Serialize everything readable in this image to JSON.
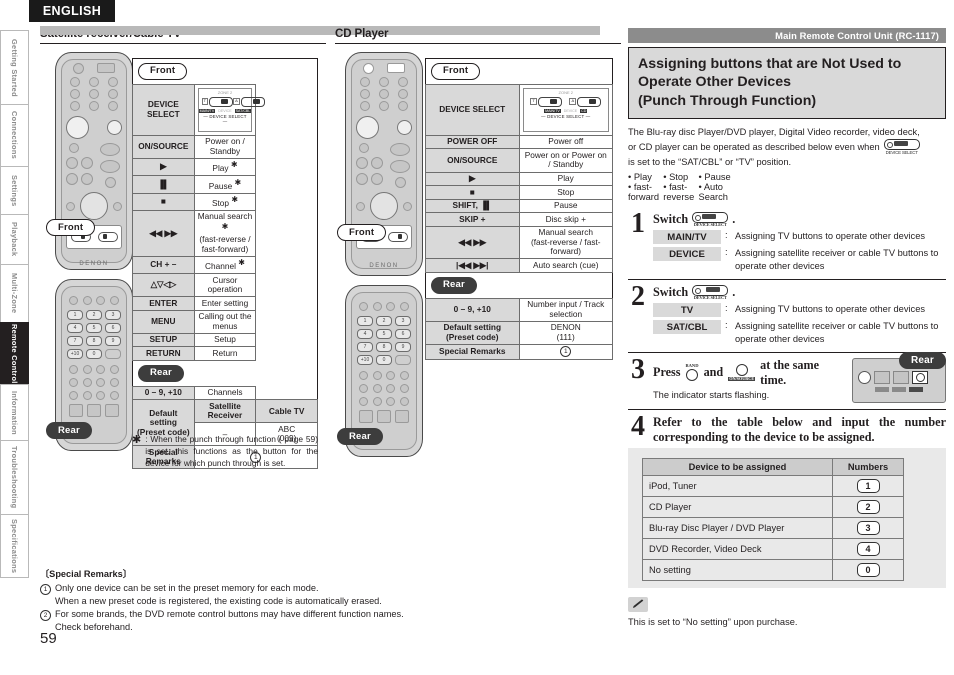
{
  "language_tab": "ENGLISH",
  "page_number": "59",
  "side_tabs": [
    {
      "label": "Getting Started",
      "active": false
    },
    {
      "label": "Connections",
      "active": false
    },
    {
      "label": "Settings",
      "active": false
    },
    {
      "label": "Playback",
      "active": false
    },
    {
      "label": "Multi-Zone",
      "active": false
    },
    {
      "label": "Remote Control",
      "active": true
    },
    {
      "label": "Information",
      "active": false
    },
    {
      "label": "Troubleshooting",
      "active": false
    },
    {
      "label": "Specifications",
      "active": false
    }
  ],
  "left_column": {
    "title": "Satellite receiver/Cable TV",
    "front_label": "Front",
    "rear_label": "Rear",
    "rows": [
      {
        "key": "DEVICE SELECT",
        "value": "",
        "type": "devsel"
      },
      {
        "key": "ON/SOURCE",
        "value": "Power on / Standby"
      },
      {
        "key": "▶",
        "value": "Play",
        "star": true
      },
      {
        "key": "▐▌",
        "value": "Pause",
        "star": true
      },
      {
        "key": "■",
        "value": "Stop",
        "star": true
      },
      {
        "key": "◀◀  ▶▶",
        "value": "Manual search",
        "value2": "(fast-reverse / fast-forward)",
        "star": true
      },
      {
        "key": "CH + –",
        "value": "Channel",
        "star": true
      },
      {
        "key": "△▽◁▷",
        "value": "Cursor operation"
      },
      {
        "key": "ENTER",
        "value": "Enter setting"
      },
      {
        "key": "MENU",
        "value": "Calling out the menus"
      },
      {
        "key": "SETUP",
        "value": "Setup"
      },
      {
        "key": "RETURN",
        "value": "Return"
      }
    ],
    "rear_rows": [
      {
        "key": "0 – 9, +10",
        "value": "Channels"
      }
    ],
    "default_setting_label": "Default setting",
    "preset_code_label": "(Preset code)",
    "preset_headers": [
      "Satellite Receiver",
      "Cable TV"
    ],
    "preset_values": [
      "–",
      "ABC (009)"
    ],
    "special_remarks_label": "Special Remarks",
    "special_remarks_value": "1",
    "footnote": ": When the punch through function ( page 59) is set, this functions as the button for the device for which punch through is set."
  },
  "mid_column": {
    "title": "CD Player",
    "front_label": "Front",
    "rear_label": "Rear",
    "rows": [
      {
        "key": "DEVICE SELECT",
        "value": "",
        "type": "devsel"
      },
      {
        "key": "POWER OFF",
        "value": "Power off"
      },
      {
        "key": "ON/SOURCE",
        "value": "Power on or Power on / Standby"
      },
      {
        "key": "▶",
        "value": "Play"
      },
      {
        "key": "■",
        "value": "Stop"
      },
      {
        "key": "SHIFT, ▐▌",
        "value": "Pause"
      },
      {
        "key": "SKIP +",
        "value": "Disc skip +"
      },
      {
        "key": "◀◀  ▶▶",
        "value": "Manual search",
        "value2": "(fast-reverse / fast-forward)"
      },
      {
        "key": "|◀◀  ▶▶|",
        "value": "Auto search (cue)"
      }
    ],
    "rear_rows": [
      {
        "key": "0 – 9, +10",
        "value": "Number input / Track selection"
      }
    ],
    "default_setting_label": "Default setting",
    "preset_code_label": "(Preset code)",
    "preset_value": "DENON",
    "preset_value2": "(111)",
    "special_remarks_label": "Special Remarks",
    "special_remarks_value": "1"
  },
  "right_column": {
    "banner": "Main Remote Control Unit (RC-1117)",
    "heading_line1": "Assigning buttons that are Not Used to",
    "heading_line2": "Operate Other Devices",
    "heading_line3": "(Punch Through Function)",
    "intro_line1": "The Blu-ray disc Player/DVD player, Digital Video recorder, video deck,",
    "intro_line2": "or CD player can be operated as described below even when",
    "intro_line3": "is set to the “SAT/CBL” or “TV” position.",
    "bullets": [
      "• Play",
      "• Stop",
      "• Pause",
      "• fast-forward",
      "• fast-reverse",
      "• Auto Search"
    ],
    "devsel_caption": "DEVICE SELECT",
    "steps": [
      {
        "number": "1",
        "lead": "Switch",
        "options": [
          {
            "key": "MAIN/TV",
            "sep": ":",
            "text": "Assigning TV buttons to operate other devices"
          },
          {
            "key": "DEVICE",
            "sep": ":",
            "text": "Assigning satellite receiver or cable TV buttons to operate other devices"
          }
        ]
      },
      {
        "number": "2",
        "lead": "Switch",
        "options": [
          {
            "key": "TV",
            "sep": ":",
            "text": "Assigning TV buttons to operate other devices"
          },
          {
            "key": "SAT/CBL",
            "sep": ":",
            "text": "Assigning satellite receiver or cable TV buttons to operate other devices"
          }
        ]
      },
      {
        "number": "3",
        "lead_pre": "Press",
        "band_label": "BAND",
        "lead_mid": "and",
        "lead_post": "at the same time.",
        "sub": "The indicator starts flashing.",
        "rear_label": "Rear"
      },
      {
        "number": "4",
        "text": "Refer to the table below and input the number corresponding to the device to be assigned."
      }
    ],
    "device_table": {
      "headers": [
        "Device to be assigned",
        "Numbers"
      ],
      "rows": [
        {
          "name": "iPod, Tuner",
          "num": "1"
        },
        {
          "name": "CD Player",
          "num": "2"
        },
        {
          "name": "Blu-ray Disc Player / DVD Player",
          "num": "3"
        },
        {
          "name": "DVD Recorder, Video Deck",
          "num": "4"
        },
        {
          "name": "No setting",
          "num": "0"
        }
      ]
    },
    "note_icon": "pencil-icon",
    "note_text": "This is set to “No setting” upon purchase."
  },
  "special_remarks": {
    "heading": "〔Special Remarks〕",
    "items": [
      {
        "num": "1",
        "line1": "Only one device can be set in the preset memory for each mode.",
        "line2": "When a new preset code is registered, the existing code is automatically erased."
      },
      {
        "num": "2",
        "line1": "For some brands, the DVD remote control buttons may have different function names.",
        "line2": "Check beforehand."
      }
    ]
  },
  "colors": {
    "banner_grey": "#8c8c8c",
    "title_fill": "#d9d9d9",
    "dark": "#231f20",
    "panel_grey": "#e9e9e9"
  }
}
